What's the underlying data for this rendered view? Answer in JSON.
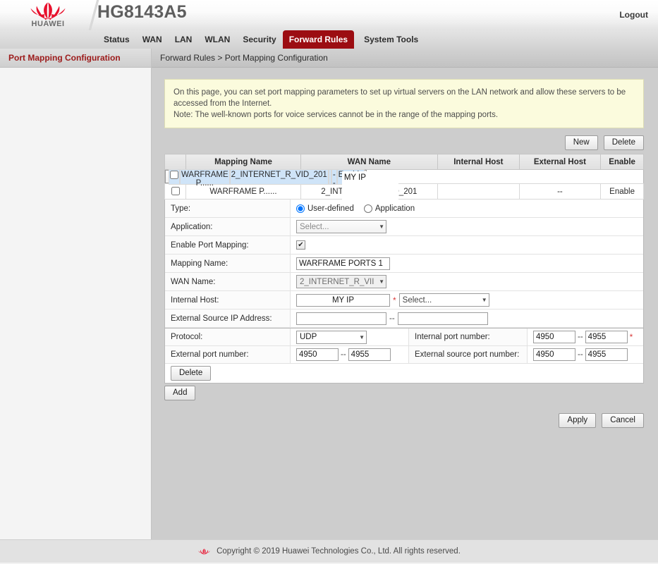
{
  "header": {
    "brand": "HUAWEI",
    "model_title": "HG8143A5",
    "logout_label": "Logout",
    "logo_icon": "huawei-fan-logo",
    "brand_color": "#9c0d12"
  },
  "nav": {
    "items": [
      {
        "label": "Status",
        "active": false
      },
      {
        "label": "WAN",
        "active": false
      },
      {
        "label": "LAN",
        "active": false
      },
      {
        "label": "WLAN",
        "active": false
      },
      {
        "label": "Security",
        "active": false
      },
      {
        "label": "Forward Rules",
        "active": true
      },
      {
        "label": "System Tools",
        "active": false
      }
    ]
  },
  "sidebar": {
    "items": [
      {
        "label": "Port Mapping Configuration",
        "active": true
      }
    ]
  },
  "breadcrumb": {
    "text": "Forward Rules > Port Mapping Configuration"
  },
  "notice": {
    "line1": "On this page, you can set port mapping parameters to set up virtual servers on the LAN network and allow these servers to be accessed from the Internet.",
    "line2": "Note: The well-known ports for voice services cannot be in the range of the mapping ports."
  },
  "table_actions": {
    "new_label": "New",
    "delete_label": "Delete"
  },
  "list_table": {
    "columns": [
      "",
      "Mapping Name",
      "WAN Name",
      "Internal Host",
      "External Host",
      "Enable"
    ],
    "rows": [
      {
        "selected": true,
        "checked": false,
        "mapping_name": "WARFRAME P......",
        "wan_name": "2_INTERNET_R_VID_201",
        "internal_host": "",
        "external_host": "--",
        "enable": "Enable"
      },
      {
        "selected": false,
        "checked": false,
        "mapping_name": "WARFRAME P......",
        "wan_name": "2_INTERNET_R_VID_201",
        "internal_host": "",
        "external_host": "--",
        "enable": "Enable"
      }
    ],
    "redaction_label": "MY IP"
  },
  "form": {
    "type": {
      "label": "Type:",
      "options": [
        {
          "label": "User-defined",
          "selected": true
        },
        {
          "label": "Application",
          "selected": false
        }
      ]
    },
    "application": {
      "label": "Application:",
      "value": "Select...",
      "placeholder": "Select..."
    },
    "enable_port_mapping": {
      "label": "Enable Port Mapping:",
      "checked": true,
      "check_glyph": "✔"
    },
    "mapping_name": {
      "label": "Mapping Name:",
      "value": "WARFRAME PORTS 1"
    },
    "wan_name": {
      "label": "WAN Name:",
      "value": "2_INTERNET_R_VII"
    },
    "internal_host": {
      "label": "Internal Host:",
      "value": "MY IP",
      "required_mark": "*",
      "select_value": "Select..."
    },
    "external_source_ip": {
      "label": "External Source IP Address:",
      "value_from": "",
      "value_to": "",
      "separator": "--"
    },
    "protocol": {
      "label": "Protocol:",
      "value": "UDP"
    },
    "internal_port": {
      "label": "Internal port number:",
      "from": "4950",
      "to": "4955",
      "separator": "--",
      "required_mark": "*"
    },
    "external_port": {
      "label": "External port number:",
      "from": "4950",
      "to": "4955",
      "separator": "--"
    },
    "external_source_port": {
      "label": "External source port number:",
      "from": "4950",
      "to": "4955",
      "separator": "--"
    },
    "delete_row_label": "Delete",
    "add_label": "Add",
    "apply_label": "Apply",
    "cancel_label": "Cancel"
  },
  "footer": {
    "copyright": "Copyright © 2019 Huawei Technologies Co., Ltd. All rights reserved.",
    "logo_icon": "huawei-fan-logo"
  }
}
